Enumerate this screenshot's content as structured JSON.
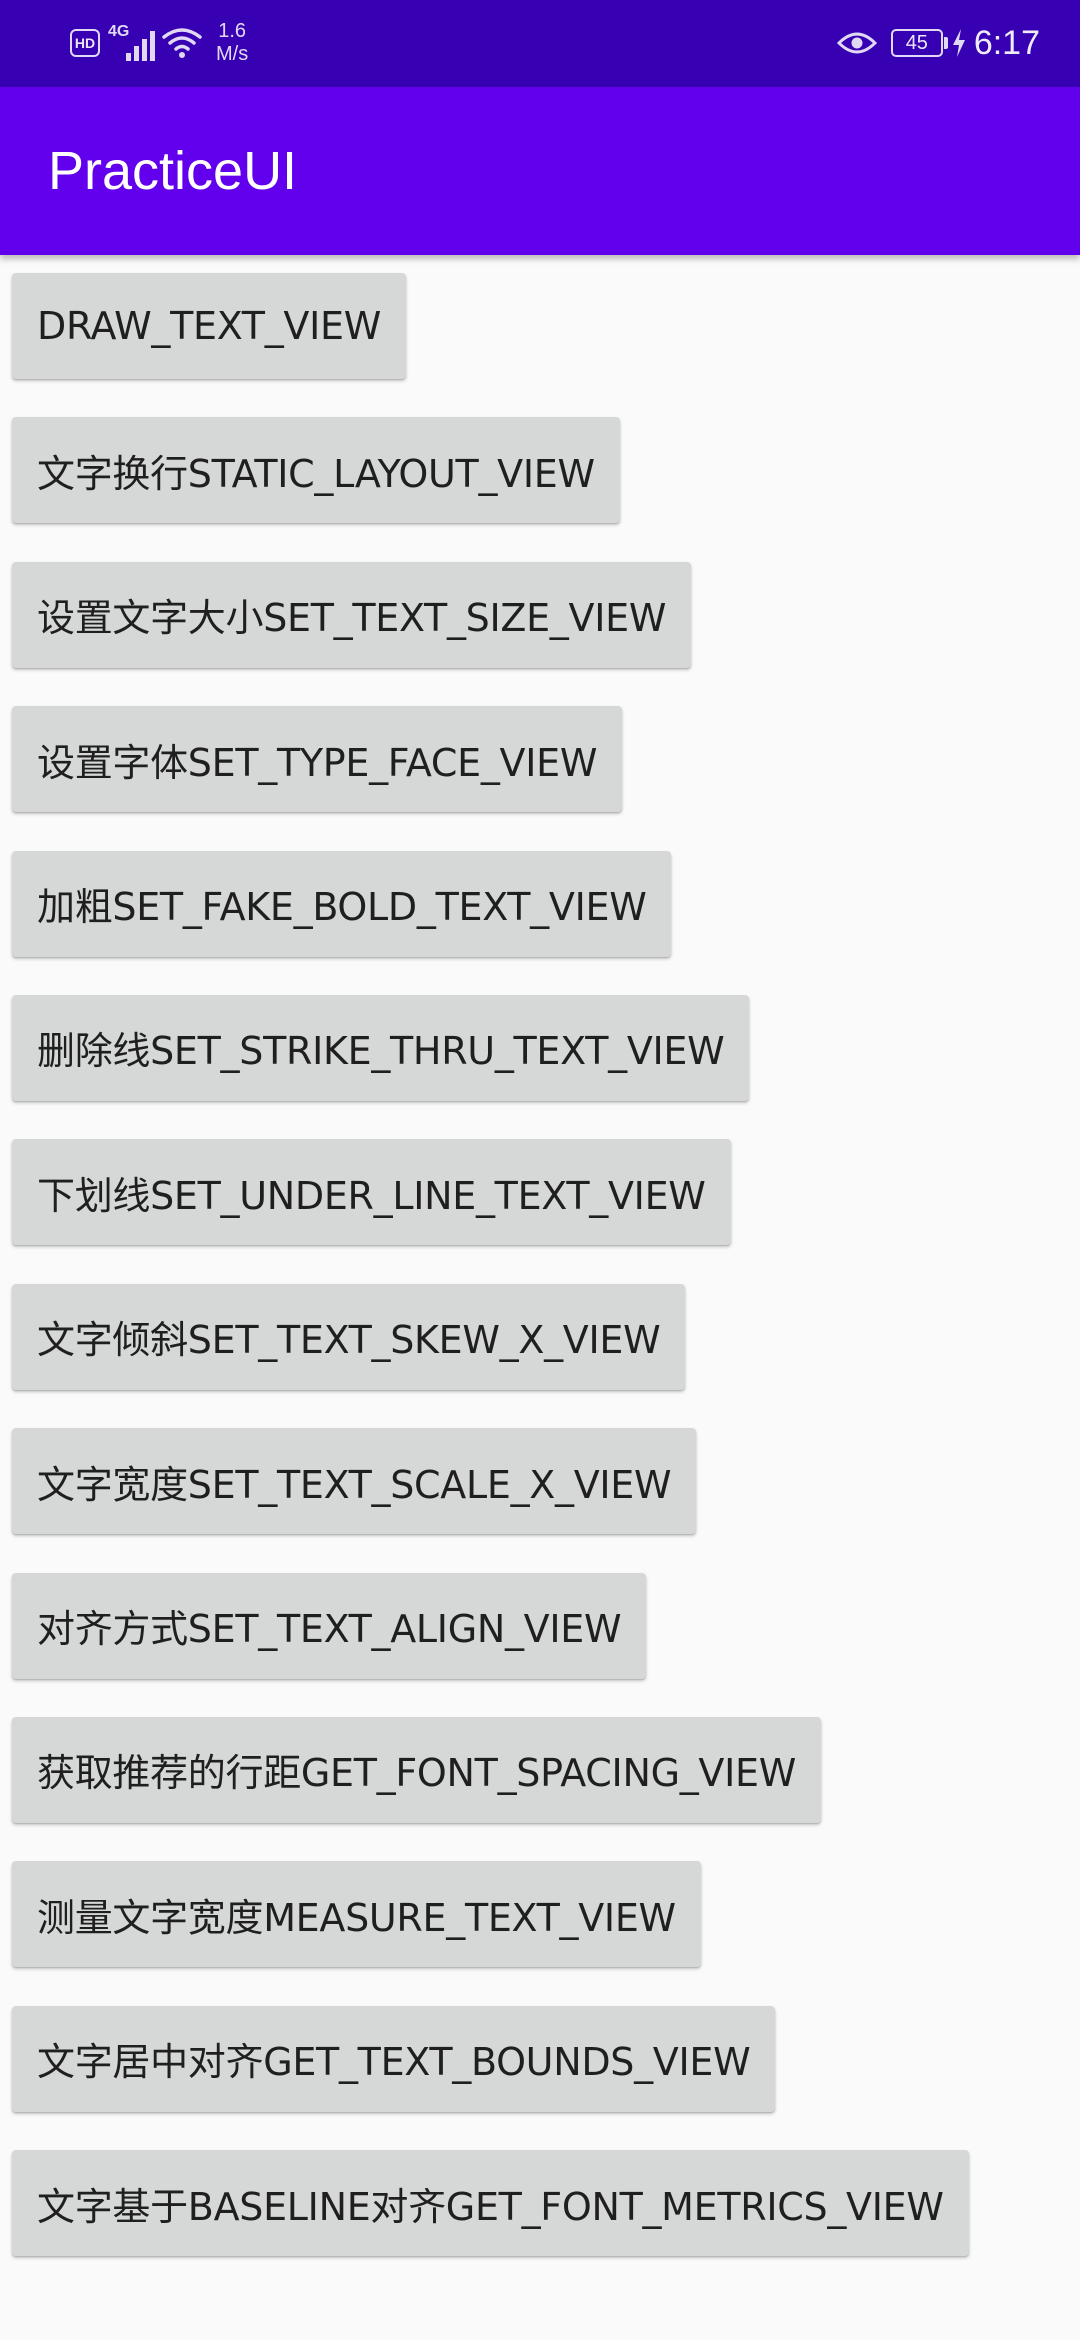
{
  "status_bar": {
    "hd_label": "HD",
    "network_label": "4G",
    "speed_value": "1.6",
    "speed_unit": "M/s",
    "battery_level": "45",
    "time": "6:17",
    "icons": [
      "hd-icon",
      "signal-icon",
      "wifi-icon",
      "eye-icon",
      "battery-icon",
      "charging-bolt-icon"
    ]
  },
  "app_bar": {
    "title": "PracticeUI",
    "background_color": "#6200ee"
  },
  "buttons": [
    {
      "label": "DRAW_TEXT_VIEW"
    },
    {
      "label": "文字换行STATIC_LAYOUT_VIEW"
    },
    {
      "label": "设置文字大小SET_TEXT_SIZE_VIEW"
    },
    {
      "label": "设置字体SET_TYPE_FACE_VIEW"
    },
    {
      "label": "加粗SET_FAKE_BOLD_TEXT_VIEW"
    },
    {
      "label": "删除线SET_STRIKE_THRU_TEXT_VIEW"
    },
    {
      "label": "下划线SET_UNDER_LINE_TEXT_VIEW"
    },
    {
      "label": "文字倾斜SET_TEXT_SKEW_X_VIEW"
    },
    {
      "label": "文字宽度SET_TEXT_SCALE_X_VIEW"
    },
    {
      "label": "对齐方式SET_TEXT_ALIGN_VIEW"
    },
    {
      "label": "获取推荐的行距GET_FONT_SPACING_VIEW"
    },
    {
      "label": "测量文字宽度MEASURE_TEXT_VIEW"
    },
    {
      "label": "文字居中对齐GET_TEXT_BOUNDS_VIEW"
    },
    {
      "label": "文字基于BASELINE对齐GET_FONT_METRICS_VIEW"
    }
  ],
  "colors": {
    "status_bar": "#3700b3",
    "app_bar": "#6200ee",
    "button_bg": "#d6d7d7",
    "page_bg": "#fafafa"
  }
}
